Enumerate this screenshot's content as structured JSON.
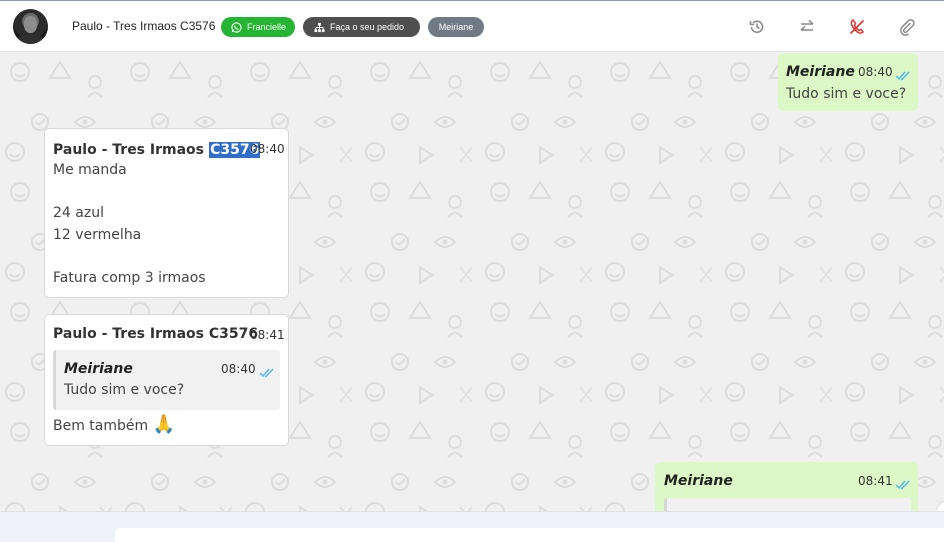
{
  "header": {
    "contact_name": "Paulo - Tres Irmaos C3576",
    "tags": {
      "whatsapp": "Francielle",
      "order": "Faça o seu pedido",
      "agent": "Meiriane"
    },
    "icons": [
      "history-icon",
      "transfer-icon",
      "end-call-icon",
      "attachment-icon"
    ],
    "colors": {
      "whatsapp_tag": "#25b532",
      "order_tag": "#4f4f4f",
      "agent_tag": "#707a86",
      "end_call": "#e0342f"
    }
  },
  "messages": [
    {
      "direction": "out",
      "sender": "Meiriane",
      "time": "08:40",
      "lines": [
        "Tudo sim e voce?"
      ]
    },
    {
      "direction": "in",
      "sender_prefix": "Paulo - Tres Irmaos",
      "sender_highlight": "C3576",
      "time": "08:40",
      "lines": [
        "Me manda",
        "",
        "24 azul",
        "12 vermelha",
        "",
        "Fatura comp 3 irmaos"
      ]
    },
    {
      "direction": "in",
      "sender": "Paulo - Tres Irmaos C3576",
      "time": "08:41",
      "quote": {
        "sender": "Meiriane",
        "time": "08:40",
        "text": "Tudo sim e voce?"
      },
      "text": "Bem também",
      "emoji": "🙏"
    },
    {
      "direction": "out",
      "sender": "Meiriane",
      "time": "08:41"
    }
  ],
  "colors": {
    "outgoing_bubble": "#dcf8c6",
    "incoming_bubble": "#ffffff",
    "read_ticks": "#4fb6ec",
    "highlight": "#2f6fc9"
  }
}
